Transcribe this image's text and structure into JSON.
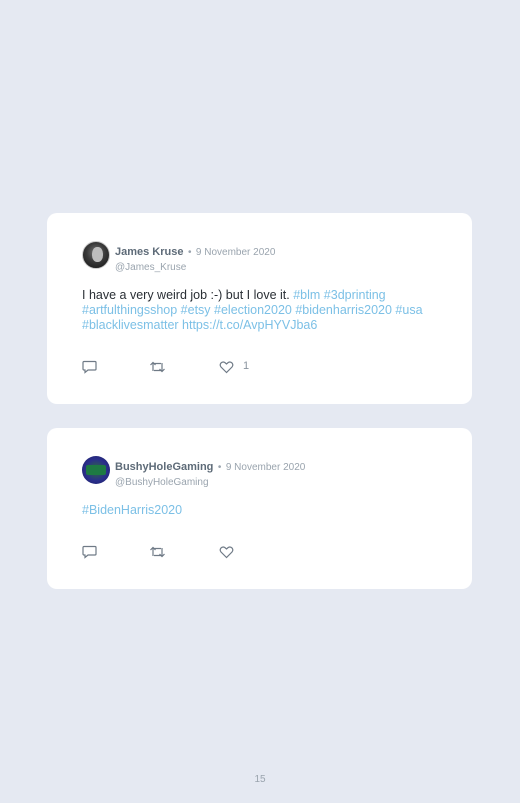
{
  "tweets": [
    {
      "author": "James Kruse",
      "separator": "•",
      "date": "9 November 2020",
      "handle": "@James_Kruse",
      "text_plain": "I have a very weird job :-) but I love it.",
      "text_links": "#blm #3dprinting #artfulthingsshop #etsy #election2020 #bidenharris2020 #usa #blacklivesmatter https://t.co/AvpHYVJba6",
      "likes": "1"
    },
    {
      "author": "BushyHoleGaming",
      "separator": "•",
      "date": "9 November 2020",
      "handle": "@BushyHoleGaming",
      "text_links": "#BidenHarris2020",
      "likes": ""
    }
  ],
  "page_number": "15",
  "icons": {
    "reply": "reply-icon",
    "retweet": "retweet-icon",
    "like": "heart-icon"
  },
  "colors": {
    "background": "#e5e9f2",
    "card": "#ffffff",
    "link": "#7cc0e6",
    "name": "#5e6b78",
    "muted": "#9aa4ae"
  }
}
